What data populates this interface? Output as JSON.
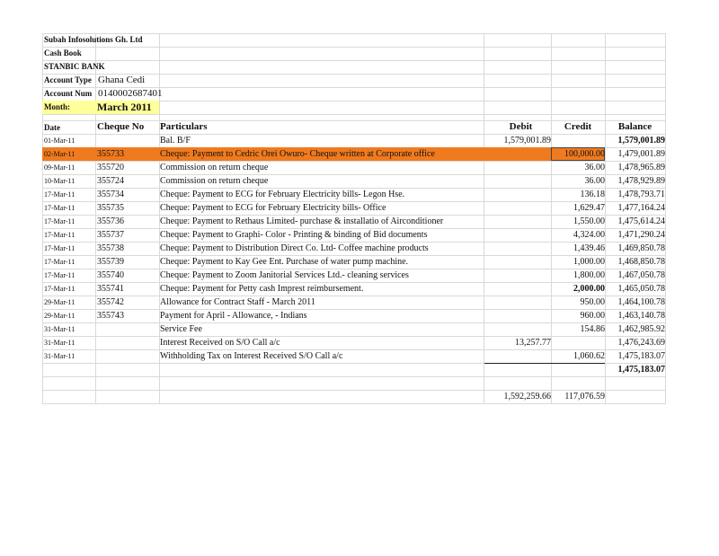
{
  "header": {
    "company": "Subah Infosolutions Gh. Ltd",
    "book": "Cash Book",
    "bank": "STANBIC BANK",
    "account_type_label": "Account Type",
    "account_type_value": "Ghana Cedi",
    "account_num_label": "Account Num",
    "account_num_value": "0140002687401",
    "month_label": "Month:",
    "month_value": "March 2011"
  },
  "columns": {
    "date": "Date",
    "cheque": "Cheque No",
    "particulars": "Particulars",
    "debit": "Debit",
    "credit": "Credit",
    "balance": "Balance"
  },
  "rows": [
    {
      "date": "01-Mar-11",
      "cheque": "",
      "particulars": "Bal. B/F",
      "debit": "1,579,001.89",
      "credit": "",
      "balance": "1,579,001.89"
    },
    {
      "date": "02-Mar-11",
      "cheque": "355733",
      "particulars": "Cheque: Payment to Cedric Orei Owuro- Cheque written at Corporate office",
      "debit": "",
      "credit": "100,000.00",
      "balance": "1,479,001.89"
    },
    {
      "date": "09-Mar-11",
      "cheque": "355720",
      "particulars": "Commission on return cheque",
      "debit": "",
      "credit": "36.00",
      "balance": "1,478,965.89"
    },
    {
      "date": "10-Mar-11",
      "cheque": "355724",
      "particulars": "Commission on return cheque",
      "debit": "",
      "credit": "36.00",
      "balance": "1,478,929.89"
    },
    {
      "date": "17-Mar-11",
      "cheque": "355734",
      "particulars": "Cheque: Payment to ECG for February Electricity bills- Legon Hse.",
      "debit": "",
      "credit": "136.18",
      "balance": "1,478,793.71"
    },
    {
      "date": "17-Mar-11",
      "cheque": "355735",
      "particulars": "Cheque: Payment to ECG for February Electricity bills- Office",
      "debit": "",
      "credit": "1,629.47",
      "balance": "1,477,164.24"
    },
    {
      "date": "17-Mar-11",
      "cheque": "355736",
      "particulars": "Cheque: Payment to Rethaus Limited- purchase & installatio of Airconditioner",
      "debit": "",
      "credit": "1,550.00",
      "balance": "1,475,614.24"
    },
    {
      "date": "17-Mar-11",
      "cheque": "355737",
      "particulars": "Cheque: Payment to Graphi- Color - Printing & binding of Bid documents",
      "debit": "",
      "credit": "4,324.00",
      "balance": "1,471,290.24"
    },
    {
      "date": "17-Mar-11",
      "cheque": "355738",
      "particulars": "Cheque: Payment to Distribution Direct Co. Ltd- Coffee machine products",
      "debit": "",
      "credit": "1,439.46",
      "balance": "1,469,850.78"
    },
    {
      "date": "17-Mar-11",
      "cheque": "355739",
      "particulars": "Cheque: Payment to Kay Gee Ent. Purchase of water pump machine.",
      "debit": "",
      "credit": "1,000.00",
      "balance": "1,468,850.78"
    },
    {
      "date": "17-Mar-11",
      "cheque": "355740",
      "particulars": "Cheque: Payment to Zoom Janitorial Services Ltd.- cleaning services",
      "debit": "",
      "credit": "1,800.00",
      "balance": "1,467,050.78"
    },
    {
      "date": "17-Mar-11",
      "cheque": "355741",
      "particulars": "Cheque: Payment for Petty cash Imprest  reimbursement.",
      "debit": "",
      "credit": "2,000.00",
      "balance": "1,465,050.78"
    },
    {
      "date": "29-Mar-11",
      "cheque": "355742",
      "particulars": "Allowance  for Contract Staff - March 2011",
      "debit": "",
      "credit": "950.00",
      "balance": "1,464,100.78"
    },
    {
      "date": "29-Mar-11",
      "cheque": "355743",
      "particulars": "Payment for April - Allowance, - Indians",
      "debit": "",
      "credit": "960.00",
      "balance": "1,463,140.78"
    },
    {
      "date": "31-Mar-11",
      "cheque": "",
      "particulars": "Service Fee",
      "debit": "",
      "credit": "154.86",
      "balance": "1,462,985.92"
    },
    {
      "date": "31-Mar-11",
      "cheque": "",
      "particulars": "Interest Received on S/O Call a/c",
      "debit": "13,257.77",
      "credit": "",
      "balance": "1,476,243.69"
    },
    {
      "date": "31-Mar-11",
      "cheque": "",
      "particulars": "Withholding Tax on Interest Received S/O Call a/c",
      "debit": "",
      "credit": "1,060.62",
      "balance": "1,475,183.07"
    }
  ],
  "closing_balance": "1,475,183.07",
  "totals": {
    "debit": "1,592,259.66",
    "credit": "117,076.59"
  },
  "colors": {
    "highlight": "#f07a1e",
    "month_fill": "#ffff99",
    "grid": "#d9d9d9"
  }
}
